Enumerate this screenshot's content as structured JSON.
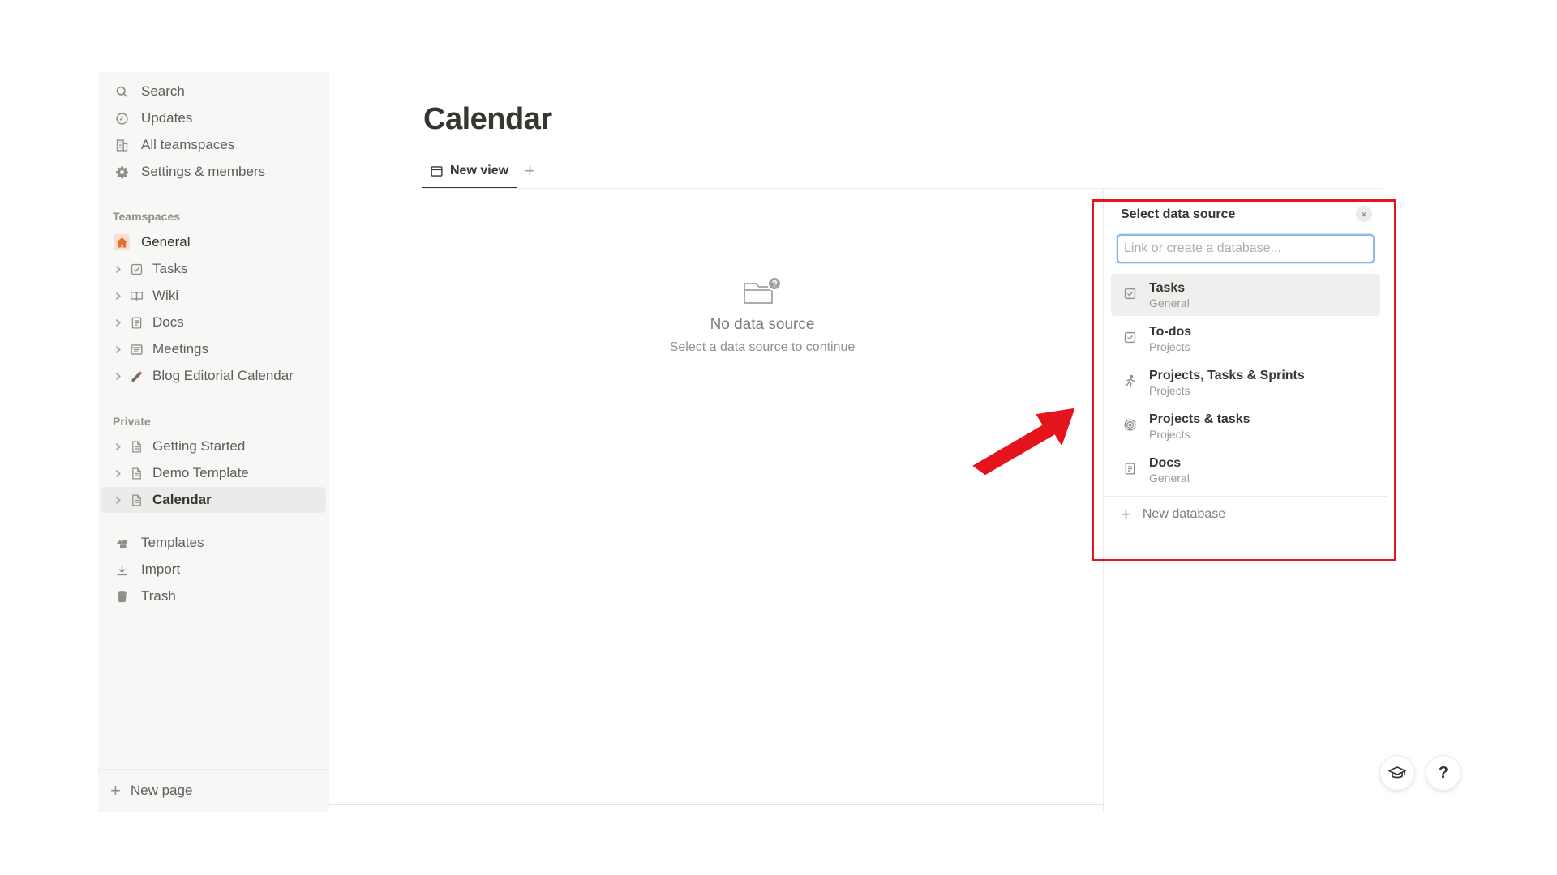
{
  "sidebar": {
    "top_items": [
      {
        "label": "Search",
        "icon": "search-icon"
      },
      {
        "label": "Updates",
        "icon": "clock-icon"
      },
      {
        "label": "All teamspaces",
        "icon": "building-icon"
      },
      {
        "label": "Settings & members",
        "icon": "gear-icon"
      }
    ],
    "teamspaces_label": "Teamspaces",
    "teamspaces": [
      {
        "label": "General",
        "icon": "home-icon"
      },
      {
        "label": "Tasks",
        "icon": "checkbox-icon"
      },
      {
        "label": "Wiki",
        "icon": "book-icon"
      },
      {
        "label": "Docs",
        "icon": "document-icon"
      },
      {
        "label": "Meetings",
        "icon": "calendar-list-icon"
      },
      {
        "label": "Blog Editorial Calendar",
        "icon": "pencil-icon"
      }
    ],
    "private_label": "Private",
    "private": [
      {
        "label": "Getting Started",
        "icon": "page-icon"
      },
      {
        "label": "Demo Template",
        "icon": "page-icon"
      },
      {
        "label": "Calendar",
        "icon": "page-icon",
        "active": true
      }
    ],
    "bottom_items": [
      {
        "label": "Templates",
        "icon": "templates-icon"
      },
      {
        "label": "Import",
        "icon": "download-icon"
      },
      {
        "label": "Trash",
        "icon": "trash-icon"
      }
    ],
    "new_page_label": "New page"
  },
  "page": {
    "title": "Calendar",
    "view_tab_label": "New view",
    "add_view": "+"
  },
  "empty_state": {
    "title": "No data source",
    "link_text": "Select a data source",
    "suffix": " to continue"
  },
  "data_source_panel": {
    "title": "Select data source",
    "close": "×",
    "search_placeholder": "Link or create a database...",
    "items": [
      {
        "name": "Tasks",
        "sub": "General",
        "icon": "checkbox-icon",
        "highlighted": true
      },
      {
        "name": "To-dos",
        "sub": "Projects",
        "icon": "checkbox-icon"
      },
      {
        "name": "Projects, Tasks & Sprints",
        "sub": "Projects",
        "icon": "runner-icon"
      },
      {
        "name": "Projects & tasks",
        "sub": "Projects",
        "icon": "target-icon"
      },
      {
        "name": "Docs",
        "sub": "General",
        "icon": "document-icon"
      }
    ],
    "new_database_label": "New database"
  },
  "help": {
    "help_label": "?"
  },
  "colors": {
    "annotation_red": "#e5141c",
    "sidebar_bg": "#f7f7f5",
    "text": "#37352f"
  }
}
